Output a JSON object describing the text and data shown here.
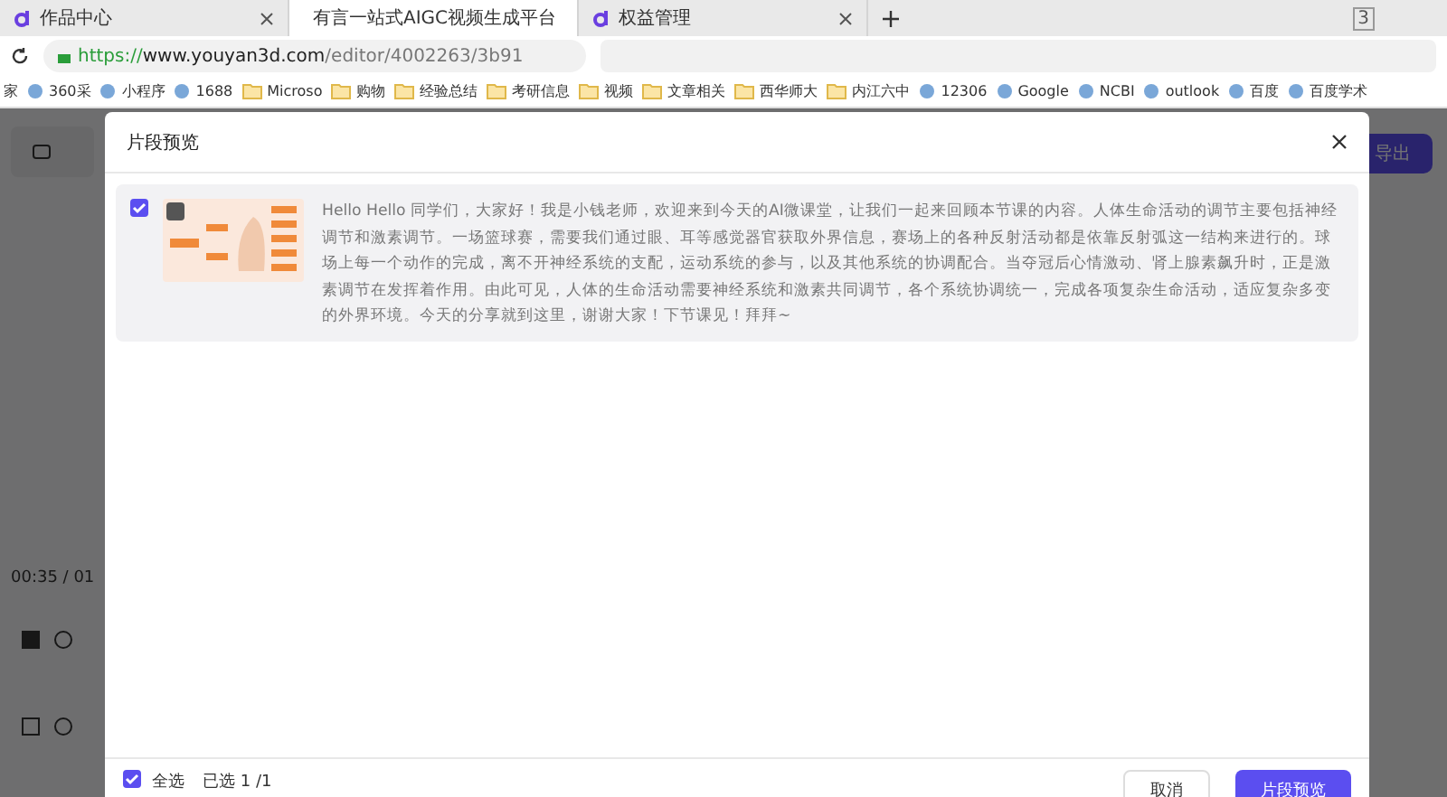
{
  "browser": {
    "tabs": [
      {
        "title": "作品中心",
        "selected": false
      },
      {
        "title": "有言一站式AIGC视频生成平台",
        "selected": true
      },
      {
        "title": "权益管理",
        "selected": false
      }
    ],
    "tab_count": "3",
    "address": {
      "scheme": "https://",
      "host": "www.youyan3d.com",
      "path": "/editor/4002263/3b91"
    },
    "bookmarks": [
      {
        "label": "家",
        "kind": "plain"
      },
      {
        "label": "360采",
        "kind": "site"
      },
      {
        "label": "小程序",
        "kind": "site"
      },
      {
        "label": "1688",
        "kind": "site"
      },
      {
        "label": "Microso",
        "kind": "folder"
      },
      {
        "label": "购物",
        "kind": "folder"
      },
      {
        "label": "经验总结",
        "kind": "folder"
      },
      {
        "label": "考研信息",
        "kind": "folder"
      },
      {
        "label": "视频",
        "kind": "folder"
      },
      {
        "label": "文章相关",
        "kind": "folder"
      },
      {
        "label": "西华师大",
        "kind": "folder"
      },
      {
        "label": "内江六中",
        "kind": "folder"
      },
      {
        "label": "12306",
        "kind": "site"
      },
      {
        "label": "Google",
        "kind": "site"
      },
      {
        "label": "NCBI",
        "kind": "site"
      },
      {
        "label": "outlook",
        "kind": "site"
      },
      {
        "label": "百度",
        "kind": "site"
      },
      {
        "label": "百度学术",
        "kind": "site"
      }
    ]
  },
  "editor": {
    "time": "00:35 / 01",
    "export_button": "导出"
  },
  "dialog": {
    "title": "片段预览",
    "segments": [
      {
        "checked": true,
        "text": "Hello Hello 同学们，大家好！我是小钱老师，欢迎来到今天的AI微课堂，让我们一起来回顾本节课的内容。人体生命活动的调节主要包括神经调节和激素调节。一场篮球赛，需要我们通过眼、耳等感觉器官获取外界信息，赛场上的各种反射活动都是依靠反射弧这一结构来进行的。球场上每一个动作的完成，离不开神经系统的支配，运动系统的参与，以及其他系统的协调配合。当夺冠后心情激动、肾上腺素飙升时，正是激素调节在发挥着作用。由此可见，人体的生命活动需要神经系统和激素共同调节，各个系统协调统一，完成各项复杂生命活动，适应复杂多变的外界环境。今天的分享就到这里，谢谢大家！下节课见！拜拜~"
      }
    ],
    "select_all": {
      "label": "全选",
      "checked": true
    },
    "selected_count": "已选 1 /1",
    "cancel_button": "取消",
    "confirm_button": "片段预览"
  }
}
